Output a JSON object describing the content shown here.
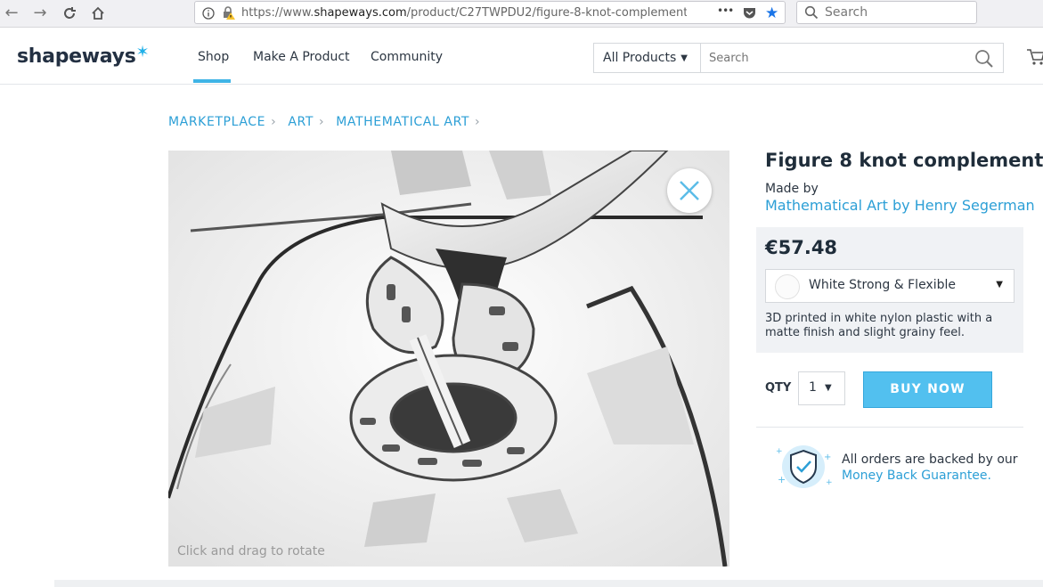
{
  "browser": {
    "url_prefix": "https://www.",
    "url_domain": "shapeways.com",
    "url_path": "/product/C27TWPDU2/figure-8-knot-complement",
    "search_placeholder": "Search",
    "more_label": "•••"
  },
  "site": {
    "logo_text": "shapeways",
    "logo_star": "✶",
    "nav": [
      "Shop",
      "Make A Product",
      "Community"
    ],
    "category_select": "All Products",
    "search_placeholder": "Search"
  },
  "breadcrumb": [
    "MARKETPLACE",
    "ART",
    "MATHEMATICAL ART"
  ],
  "viewer": {
    "hint": "Click and drag to rotate"
  },
  "product": {
    "title": "Figure 8 knot complement",
    "made_by_label": "Made by",
    "author": "Mathematical Art by Henry Segerman",
    "price": "€57.48",
    "material": "White Strong & Flexible",
    "material_description": "3D printed in white nylon plastic with a matte finish and slight grainy feel.",
    "qty_label": "QTY",
    "qty_value": "1",
    "buy_label": "BUY NOW",
    "guarantee_text": "All orders are backed by our",
    "guarantee_link": "Money Back Guarantee."
  },
  "colors": {
    "accent": "#2c9fd6",
    "button": "#52c0ef",
    "panel": "#f0f2f5"
  }
}
